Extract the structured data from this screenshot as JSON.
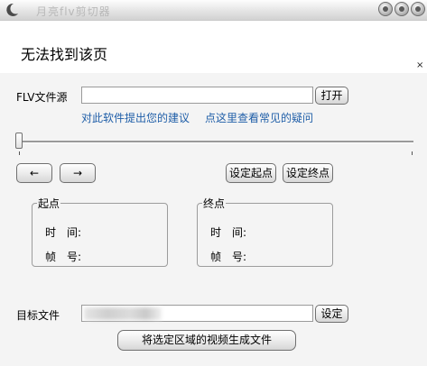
{
  "window": {
    "title": "月亮flv剪切器",
    "app_icon": "moon-icon",
    "controls": [
      "minimize-button",
      "maximize-button",
      "close-button"
    ]
  },
  "notice": {
    "title": "无法找到该页",
    "close_glyph": "×"
  },
  "source": {
    "label": "FLV文件源",
    "value": "",
    "open_label": "打开"
  },
  "links": {
    "suggest": "对此软件提出您的建议",
    "faq": "点这里查看常见的疑问"
  },
  "navigation": {
    "prev_label": "←",
    "next_label": "→",
    "set_start_label": "设定起点",
    "set_end_label": "设定终点"
  },
  "start_group": {
    "title": "起点",
    "time_label": "时　间:",
    "frame_label": "帧　号:"
  },
  "end_group": {
    "title": "终点",
    "time_label": "时　间:",
    "frame_label": "帧　号:"
  },
  "target": {
    "label": "目标文件",
    "value": "",
    "set_label": "设定"
  },
  "generate_label": "将选定区域的视频生成文件",
  "slider": {
    "position": 0
  },
  "colors": {
    "link": "#1f5ea8",
    "window_bg": "#f4f4f4",
    "title_text": "#b8b8b8"
  }
}
